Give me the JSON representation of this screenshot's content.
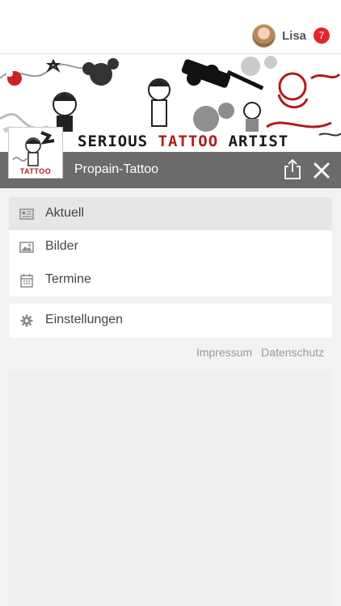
{
  "user": {
    "name": "Lisa",
    "notification_count": "7"
  },
  "banner": {
    "title_part1": "SERIOUS ",
    "title_part2": "TATTOO",
    "title_part3": " ARTIST"
  },
  "app": {
    "name": "Propain-Tattoo",
    "logo_text": "TATTOO"
  },
  "menu": {
    "items": [
      {
        "label": "Aktuell",
        "icon": "newspaper-icon",
        "active": true
      },
      {
        "label": "Bilder",
        "icon": "image-icon",
        "active": false
      },
      {
        "label": "Termine",
        "icon": "calendar-icon",
        "active": false
      }
    ],
    "settings_label": "Einstellungen"
  },
  "footer": {
    "impressum": "Impressum",
    "datenschutz": "Datenschutz"
  },
  "colors": {
    "accent_red": "#e0262b",
    "app_bar": "#6b6b6b",
    "tattoo_red": "#b01c1c"
  }
}
